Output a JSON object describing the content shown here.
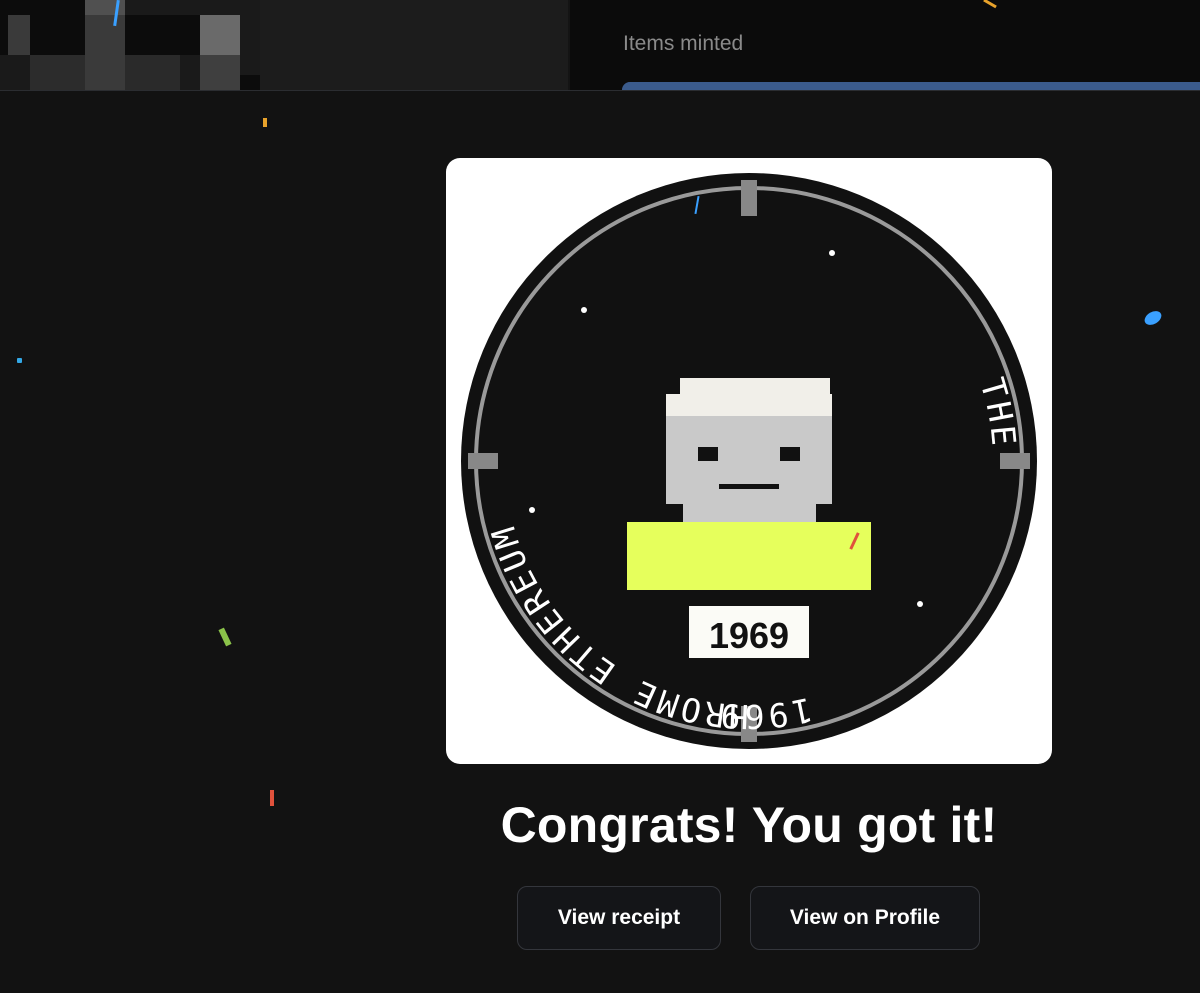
{
  "header": {
    "items_minted_label": "Items minted",
    "mint_progress": 1.0
  },
  "token": {
    "ring_text_top": "1969",
    "ring_text_right": "ETHEREUM",
    "ring_text_bottom": "MONOCHROME",
    "ring_text_left": "THE",
    "badge_number": "1969"
  },
  "result": {
    "title": "Congrats! You got it!"
  },
  "actions": {
    "view_receipt_label": "View receipt",
    "view_profile_label": "View on Profile"
  },
  "colors": {
    "accent_yellow": "#e6ff5c",
    "progress": "#3b5b8c"
  }
}
